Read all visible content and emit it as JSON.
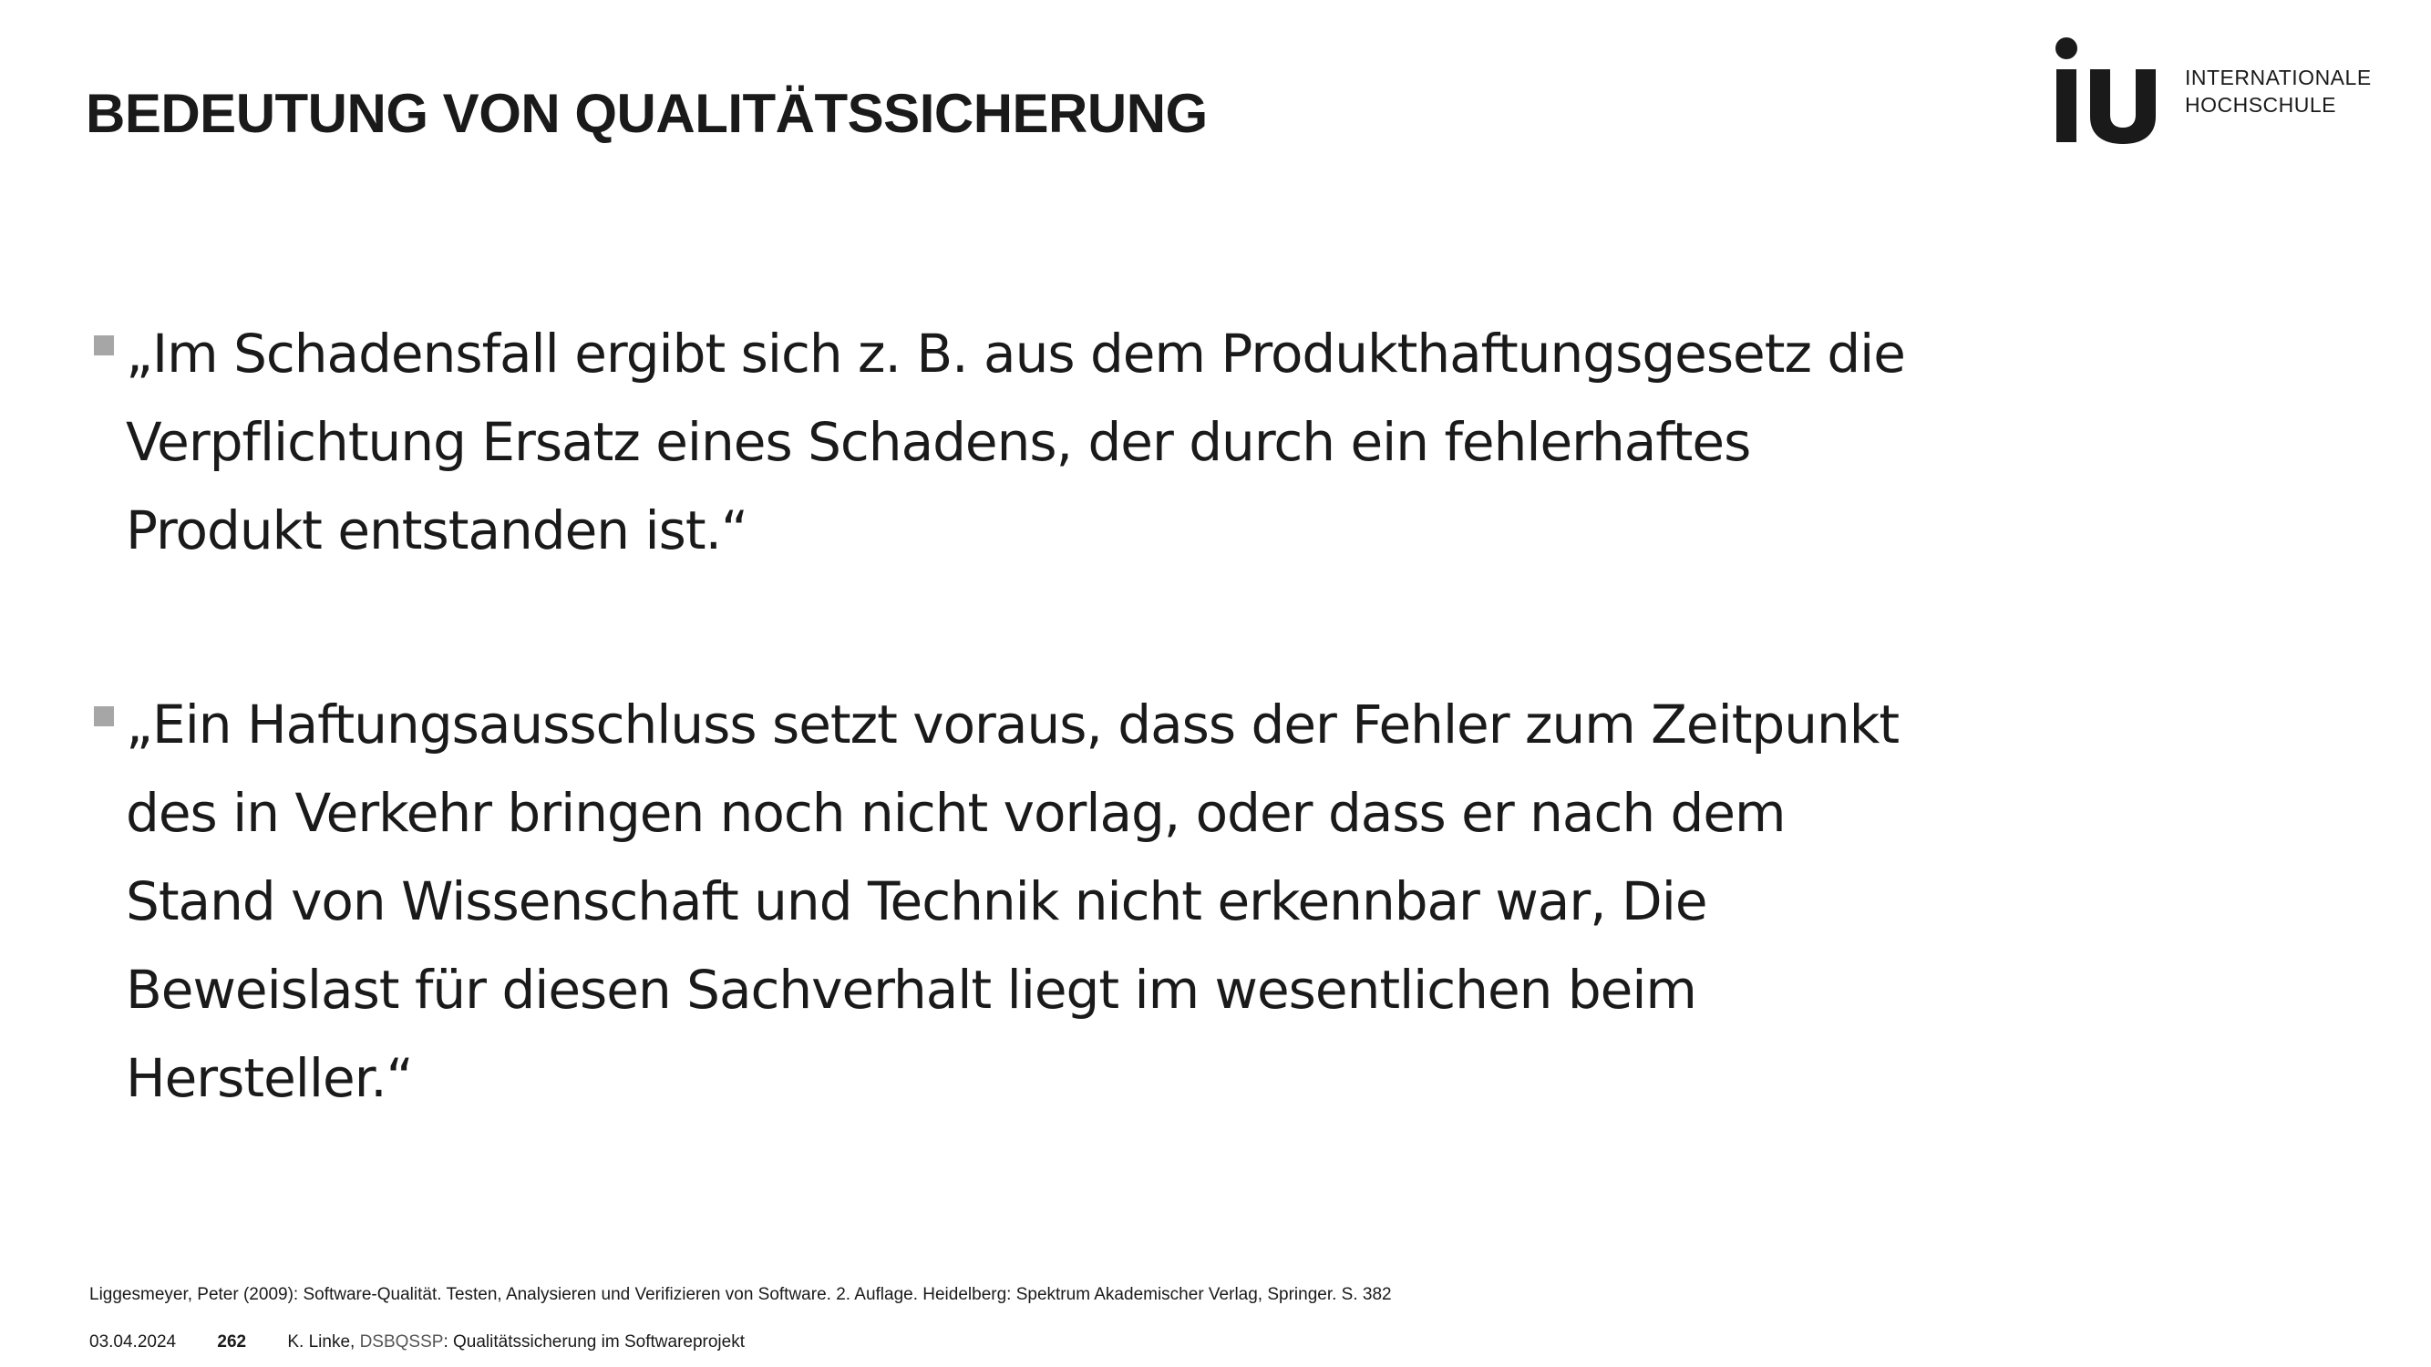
{
  "title": "BEDEUTUNG VON QUALITÄTSSICHERUNG",
  "logo": {
    "line1": "INTERNATIONALE",
    "line2": "HOCHSCHULE",
    "mark_letters": "iu"
  },
  "bullets": [
    {
      "lines": [
        "„Im Schadensfall ergibt sich z. B. aus dem Produkthaftungsgesetz die",
        "Verpflichtung Ersatz eines Schadens, der durch ein fehlerhaftes",
        "Produkt entstanden ist.“"
      ]
    },
    {
      "lines": [
        "„Ein Haftungsausschluss setzt voraus, dass der Fehler zum Zeitpunkt",
        "des in Verkehr bringen noch nicht vorlag, oder dass er nach dem",
        "Stand von Wissenschaft und Technik nicht erkennbar war, Die",
        "Beweislast für diesen Sachverhalt liegt im wesentlichen beim",
        "Hersteller.“"
      ]
    }
  ],
  "footnote": "Liggesmeyer, Peter (2009): Software-Qualität. Testen, Analysieren und Verifizieren von Software. 2. Auflage. Heidelberg: Spektrum Akademischer Verlag, Springer. S. 382",
  "footer": {
    "date": "03.04.2024",
    "page_number": "262",
    "author": "K. Linke,",
    "course_code": "DSBQSSP",
    "course_title": ": Qualitätssicherung im Softwareprojekt"
  },
  "colors": {
    "text": "#1a1a1a",
    "bullet_marker": "#a6a6a6",
    "course_code": "#555555"
  }
}
